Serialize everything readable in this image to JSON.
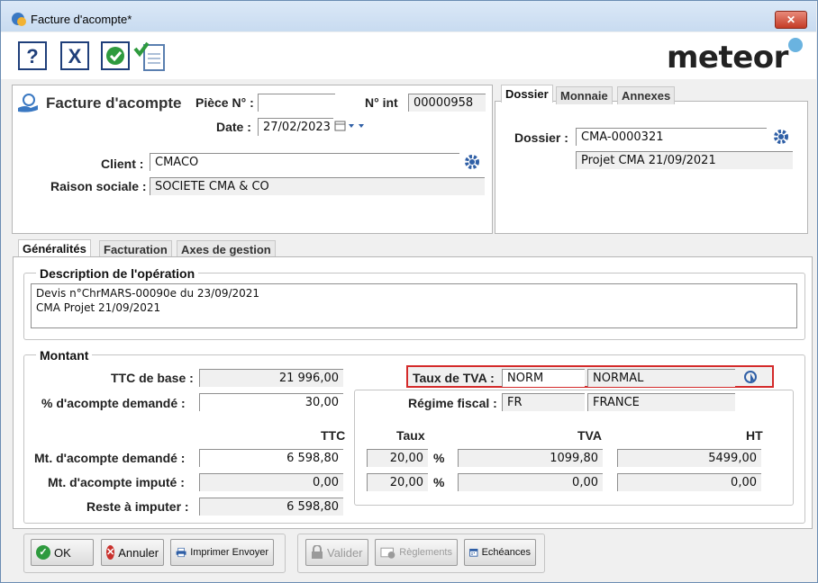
{
  "window": {
    "title": "Facture d'acompte*",
    "close": "✕"
  },
  "brand": {
    "name": "meteor"
  },
  "toolbar": {
    "help": "?",
    "cancel": "X"
  },
  "header": {
    "section_title": "Facture d'acompte",
    "piece_label": "Pièce N° :",
    "piece_value": "",
    "nint_label": "N° int",
    "nint_value": "00000958",
    "date_label": "Date :",
    "date_value": "27/02/2023",
    "client_label": "Client :",
    "client_value": "CMACO",
    "raison_label": "Raison sociale :",
    "raison_value": "SOCIETE CMA & CO"
  },
  "right_tabs": [
    "Dossier",
    "Monnaie",
    "Annexes"
  ],
  "dossier": {
    "label": "Dossier :",
    "code": "CMA-0000321",
    "name": "Projet CMA 21/09/2021"
  },
  "main_tabs": [
    "Généralités",
    "Facturation",
    "Axes de gestion"
  ],
  "description": {
    "title": "Description de l'opération",
    "line1": "Devis n°ChrMARS-00090e du 23/09/2021",
    "line2": "CMA Projet 21/09/2021"
  },
  "montant": {
    "title": "Montant",
    "ttc_base_label": "TTC de base :",
    "ttc_base_value": "21 996,00",
    "pct_label": "% d'acompte demandé :",
    "pct_value": "30,00",
    "col_ttc": "TTC",
    "mt_demande_label": "Mt. d'acompte demandé :",
    "mt_demande_value": "6 598,80",
    "mt_impute_label": "Mt. d'acompte imputé :",
    "mt_impute_value": "0,00",
    "reste_label": "Reste à imputer :",
    "reste_value": "6 598,80"
  },
  "tva": {
    "taux_label": "Taux de TVA :",
    "taux_code": "NORM",
    "taux_name": "NORMAL",
    "regime_label": "Régime fiscal :",
    "regime_code": "FR",
    "regime_name": "FRANCE",
    "col_taux": "Taux",
    "col_tva": "TVA",
    "col_ht": "HT",
    "pct_sign": "%",
    "rows": [
      {
        "taux": "20,00",
        "tva": "1099,80",
        "ht": "5499,00"
      },
      {
        "taux": "20,00",
        "tva": "0,00",
        "ht": "0,00"
      }
    ]
  },
  "buttons": {
    "ok": "OK",
    "annuler": "Annuler",
    "imprimer": "Imprimer Envoyer",
    "valider": "Valider",
    "reglements": "Règlements",
    "echeances": "Echéances"
  }
}
